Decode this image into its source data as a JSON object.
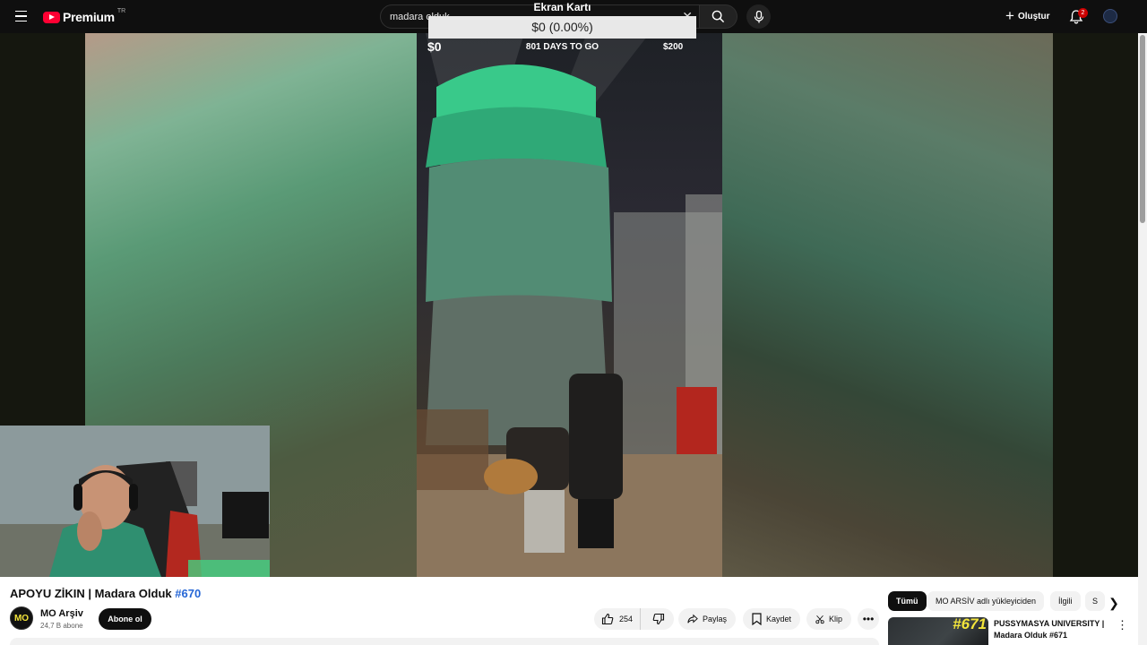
{
  "header": {
    "logo_text": "Premium",
    "country_code": "TR",
    "search_value": "madara olduk",
    "clear_symbol": "✕",
    "create_label": "Oluştur",
    "notification_count": "2",
    "icons": [
      "menu-icon",
      "search-icon",
      "mic-icon",
      "plus-icon",
      "bell-icon"
    ]
  },
  "overlay": {
    "title": "Ekran Kartı",
    "amount": "$0 (0.00%)",
    "min_label": "$0",
    "days_label": "801 DAYS TO GO",
    "max_label": "$200",
    "progress": 0
  },
  "video": {
    "title": "APOYU ZİKIN | Madara Olduk",
    "tag": "#670"
  },
  "channel": {
    "avatar_text": "MO",
    "name": "MO Arşiv",
    "subs": "24,7 B abone",
    "subscribe_label": "Abone ol"
  },
  "actions": {
    "likes": "254",
    "share": "Paylaş",
    "save": "Kaydet",
    "clip": "Klip",
    "more": "•••"
  },
  "chips": [
    "Tümü",
    "MO ARSİV adlı yükleyiciden",
    "İlgili",
    "S"
  ],
  "recommendation": {
    "thumb_number": "#671",
    "title": "PUSSYMASYA UNIVERSITY | Madara Olduk #671",
    "more": "⋮"
  },
  "colors": {
    "brand_red": "#ff0033",
    "link_blue": "#2566d6",
    "dark": "#0f0f0f"
  }
}
